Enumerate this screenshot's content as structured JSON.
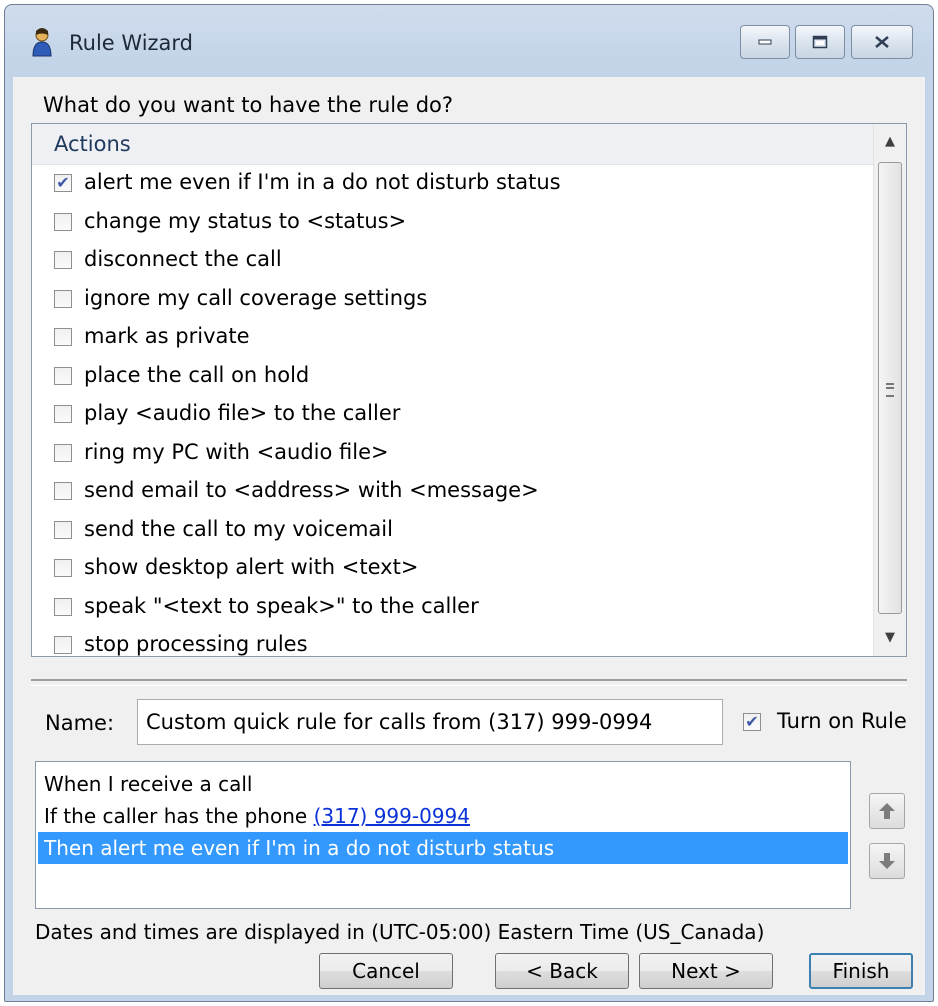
{
  "window": {
    "title": "Rule Wizard"
  },
  "prompt": "What do you want to have the rule do?",
  "actions": {
    "header": "Actions",
    "items": [
      {
        "label": "alert me even if I'm in a do not disturb status",
        "checked": true
      },
      {
        "label": "change my status to <status>",
        "checked": false
      },
      {
        "label": "disconnect the call",
        "checked": false
      },
      {
        "label": "ignore my call coverage settings",
        "checked": false
      },
      {
        "label": "mark as private",
        "checked": false
      },
      {
        "label": "place the call on hold",
        "checked": false
      },
      {
        "label": "play <audio file> to the caller",
        "checked": false
      },
      {
        "label": "ring my PC with <audio file>",
        "checked": false
      },
      {
        "label": "send email to <address> with <message>",
        "checked": false
      },
      {
        "label": "send the call to my voicemail",
        "checked": false
      },
      {
        "label": "show desktop alert with <text>",
        "checked": false
      },
      {
        "label": "speak \"<text to speak>\" to the caller",
        "checked": false
      },
      {
        "label": "stop processing rules",
        "checked": false
      }
    ]
  },
  "name_field": {
    "label": "Name:",
    "value": "Custom quick rule for calls from (317) 999-0994"
  },
  "turn_on_rule": {
    "label": "Turn on Rule",
    "checked": true
  },
  "summary": {
    "line1": "When I receive a call",
    "line2_prefix": "If the caller has the phone ",
    "line2_link": "(317) 999-0994",
    "line3": "Then alert me even if I'm in a do not disturb status"
  },
  "timezone_note": "Dates and times are displayed in (UTC-05:00) Eastern Time (US_Canada)",
  "buttons": {
    "cancel": "Cancel",
    "back": "< Back",
    "next": "Next >",
    "finish": "Finish"
  },
  "colors": {
    "selection": "#3399ff",
    "link": "#0b32d8",
    "checkmark": "#4059a6"
  }
}
